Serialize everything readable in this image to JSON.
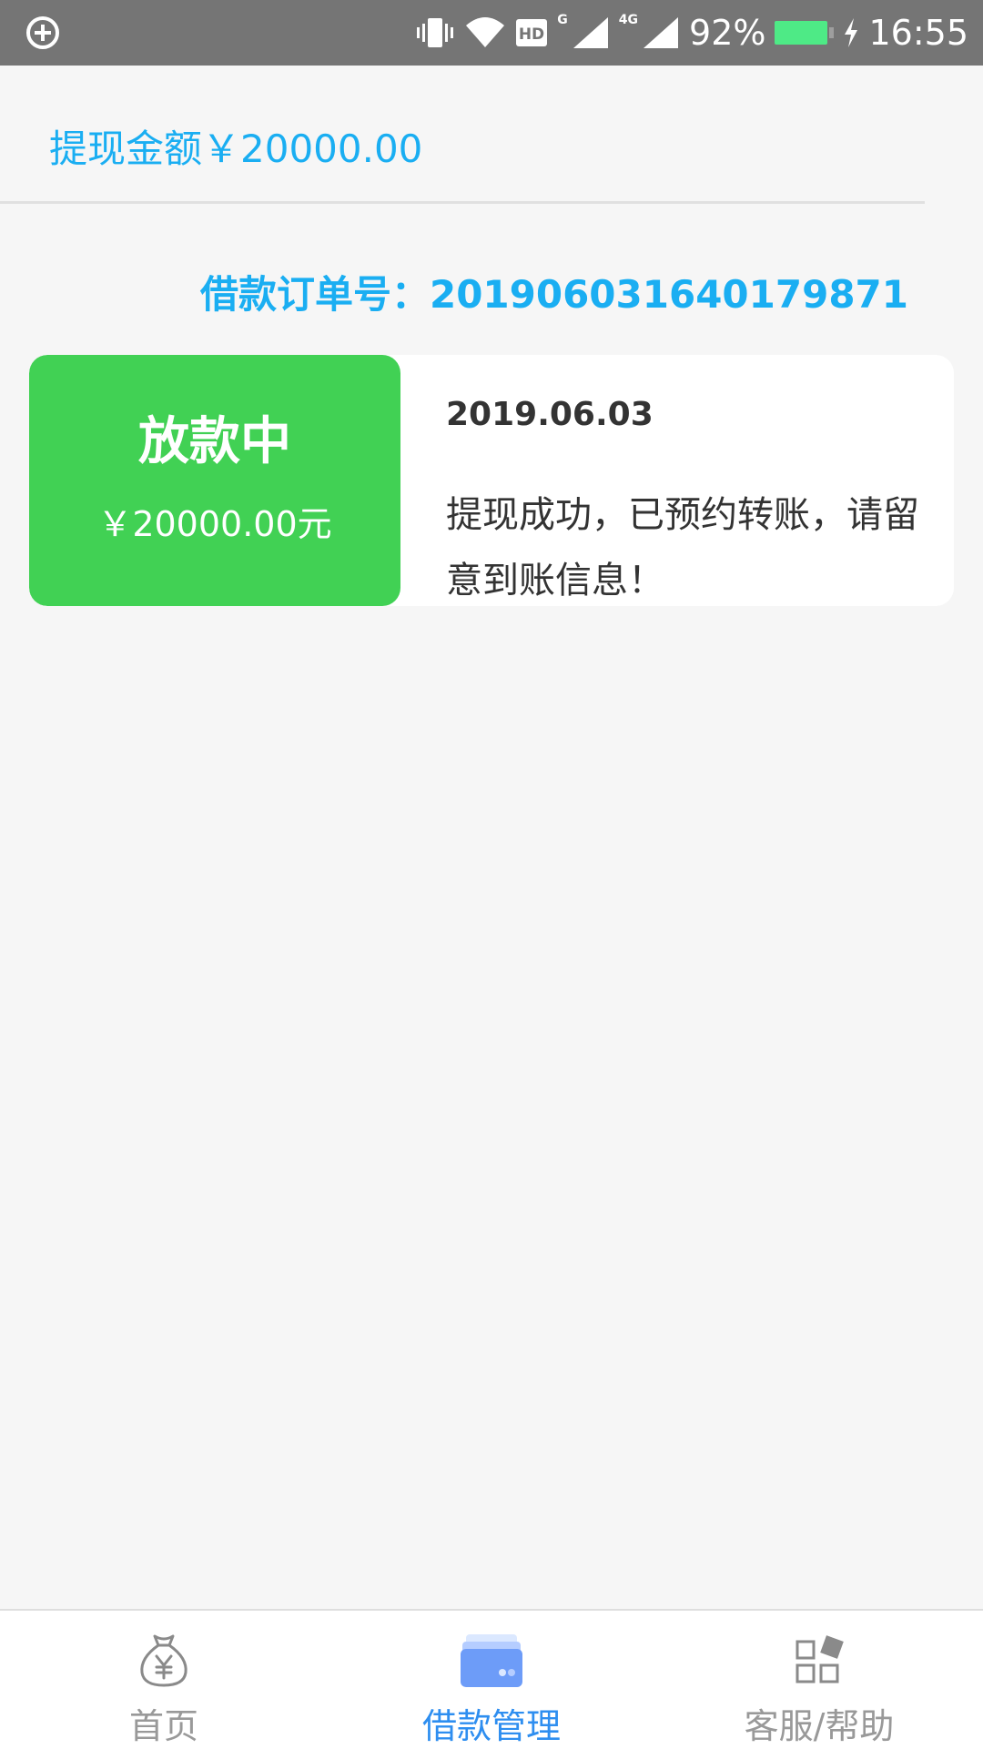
{
  "status_bar": {
    "battery_percent": "92%",
    "time": "16:55",
    "hd_label": "HD",
    "g_label": "G",
    "lte_label": "4G",
    "icons": [
      "vibrate-icon",
      "wifi-icon",
      "signal-icon",
      "battery-icon",
      "charging-icon"
    ]
  },
  "header": {
    "withdraw_amount": "提现金额￥20000.00"
  },
  "order": {
    "label": "借款订单号：",
    "number": "201906031640179871"
  },
  "card": {
    "status_title": "放款中",
    "amount": "￥20000.00元",
    "date": "2019.06.03",
    "message": "提现成功，已预约转账，请留意到账信息！",
    "status_color": "#41d154"
  },
  "tabs": [
    {
      "label": "首页",
      "icon": "money-bag-icon",
      "active": false
    },
    {
      "label": "借款管理",
      "icon": "wallet-icon",
      "active": true
    },
    {
      "label": "客服/帮助",
      "icon": "grid-apps-icon",
      "active": false
    }
  ],
  "colors": {
    "accent": "#1aaef2",
    "tab_active": "#2e8ef0",
    "tab_inactive": "#999999"
  }
}
